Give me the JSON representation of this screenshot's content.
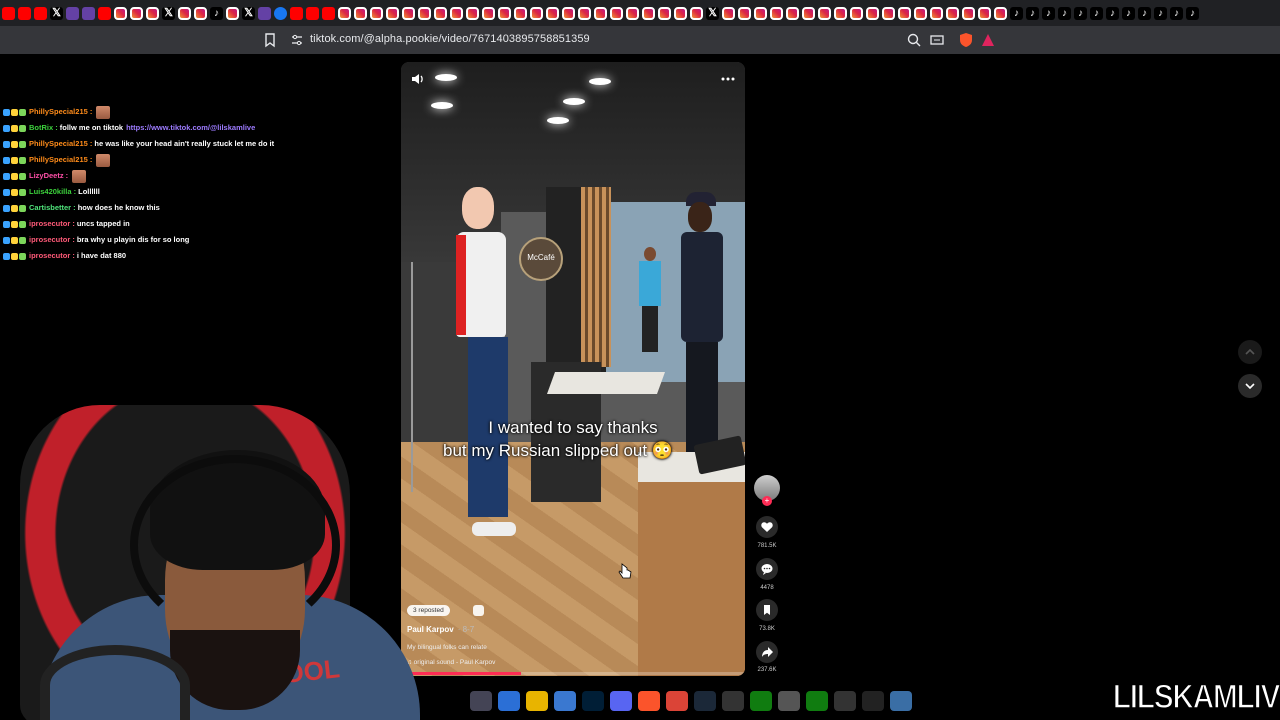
{
  "browser": {
    "tabs": [
      "pinterest",
      "pinterest",
      "youtube",
      "x",
      "twitch",
      "twitch",
      "yt",
      "ig",
      "ig",
      "ig",
      "x",
      "ig",
      "ig",
      "tt",
      "ig",
      "x",
      "twitch",
      "fb",
      "yt",
      "yt",
      "yt",
      "ig",
      "ig",
      "ig",
      "ig",
      "ig",
      "ig",
      "ig",
      "ig",
      "ig",
      "ig",
      "ig",
      "ig",
      "ig",
      "ig",
      "ig",
      "ig",
      "ig",
      "ig",
      "ig",
      "ig",
      "ig",
      "ig",
      "ig",
      "x",
      "ig",
      "ig",
      "ig",
      "ig",
      "ig",
      "ig",
      "ig",
      "ig",
      "ig",
      "ig",
      "ig",
      "ig",
      "ig",
      "ig",
      "ig",
      "ig",
      "ig",
      "ig",
      "tt",
      "tt",
      "tt",
      "tt",
      "tt",
      "tt",
      "tt",
      "tt",
      "tt",
      "tt",
      "tt",
      "tt"
    ],
    "url": "tiktok.com/@alpha.pookie/video/7671403895758851359"
  },
  "chat": [
    {
      "user": "PhillySpecial215",
      "color": "#ff8c1a",
      "msg": "",
      "emote": true
    },
    {
      "user": "BotRix",
      "color": "#3cd13c",
      "msg": "follw me on tiktok",
      "link": "https://www.tiktok.com/@lilskamlive"
    },
    {
      "user": "PhillySpecial215",
      "color": "#ff8c1a",
      "msg": "he was like your head ain't really stuck let me do it"
    },
    {
      "user": "PhillySpecial215",
      "color": "#ff8c1a",
      "msg": "",
      "emote": true
    },
    {
      "user": "LizyDeetz",
      "color": "#ff4fa8",
      "msg": "",
      "emote": true
    },
    {
      "user": "Luis420killa",
      "color": "#3cd13c",
      "msg": "Lollllll"
    },
    {
      "user": "Cartisbetter",
      "color": "#4fe37a",
      "msg": "how does he know this"
    },
    {
      "user": "iprosecutor",
      "color": "#ff5a78",
      "msg": "uncs tapped in"
    },
    {
      "user": "iprosecutor",
      "color": "#ff5a78",
      "msg": "bra why u playin dis for so long"
    },
    {
      "user": "iprosecutor",
      "color": "#ff5a78",
      "msg": "i have dat 880"
    }
  ],
  "video": {
    "caption_line1": "I wanted to say thanks",
    "caption_line2": "but my Russian slipped out 😳",
    "sign_text": "McCafé",
    "reposted": "3 reposted",
    "author": "Paul Karpov",
    "date": "· 8-7",
    "description": "My bilingual folks can relate",
    "sound": "♫ original sound - Paul Karpov",
    "progress": 0.35
  },
  "actions": {
    "likes": "781.5K",
    "comments": "4478",
    "saves": "73.8K",
    "shares": "237.6K"
  },
  "webcam_shirt_text": "SCHOOL",
  "taskbar": [
    "chat",
    "copilot",
    "files",
    "store",
    "ps",
    "discord",
    "brave",
    "chrome",
    "steam",
    "ntt",
    "xbox",
    "4k",
    "xbox2",
    "note",
    "obs",
    "monitor"
  ],
  "brand": "LILSKAMLIVE",
  "colors": {
    "accent": "#fe2c55",
    "background": "#000000"
  }
}
